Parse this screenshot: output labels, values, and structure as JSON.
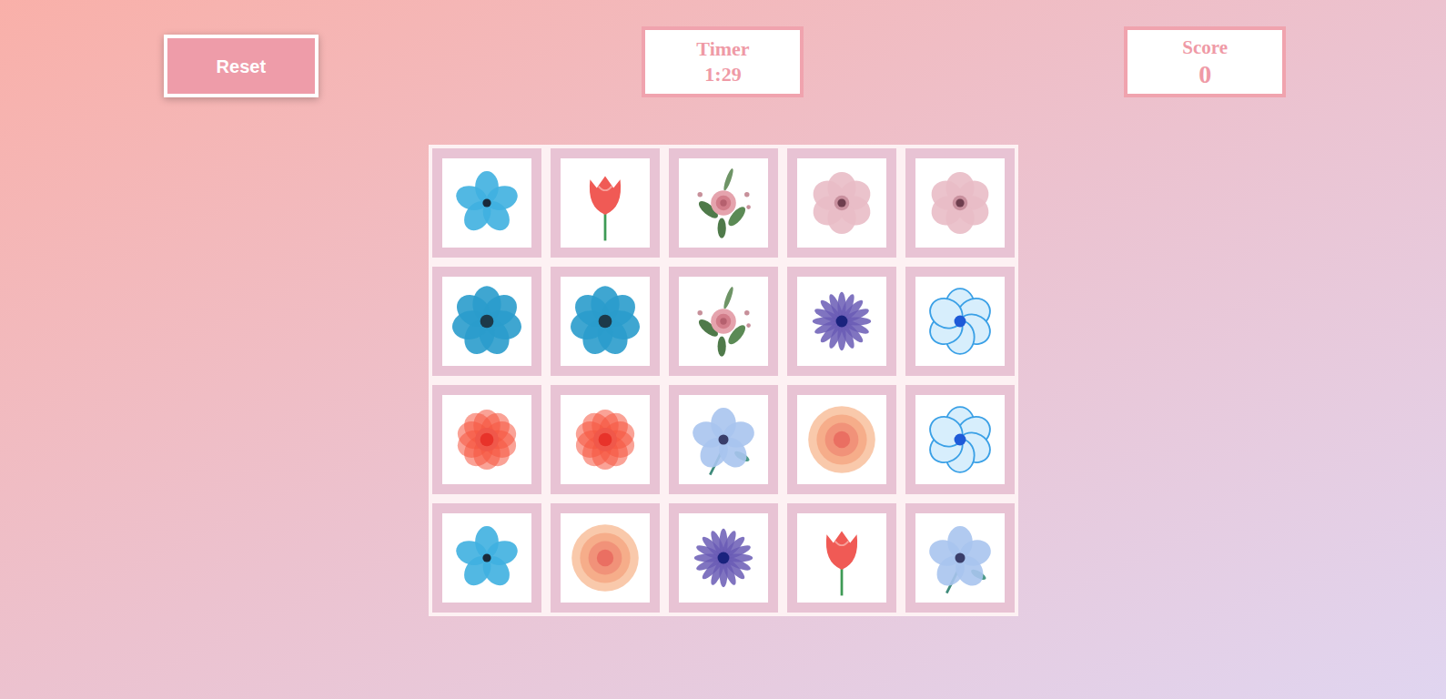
{
  "reset": "Reset",
  "timer": {
    "label": "Timer",
    "value": "1:29"
  },
  "score": {
    "label": "Score",
    "value": "0"
  },
  "cards": [
    {
      "kind": "blue-five"
    },
    {
      "kind": "tulip"
    },
    {
      "kind": "rose-sprig"
    },
    {
      "kind": "pink-anemone"
    },
    {
      "kind": "pink-anemone"
    },
    {
      "kind": "blue-anemone"
    },
    {
      "kind": "blue-anemone"
    },
    {
      "kind": "rose-sprig"
    },
    {
      "kind": "purple-daisy"
    },
    {
      "kind": "blue-outline"
    },
    {
      "kind": "red-peony"
    },
    {
      "kind": "red-peony"
    },
    {
      "kind": "periwinkle"
    },
    {
      "kind": "peach-rose"
    },
    {
      "kind": "blue-outline"
    },
    {
      "kind": "blue-five"
    },
    {
      "kind": "peach-rose"
    },
    {
      "kind": "purple-daisy"
    },
    {
      "kind": "tulip"
    },
    {
      "kind": "periwinkle"
    }
  ]
}
